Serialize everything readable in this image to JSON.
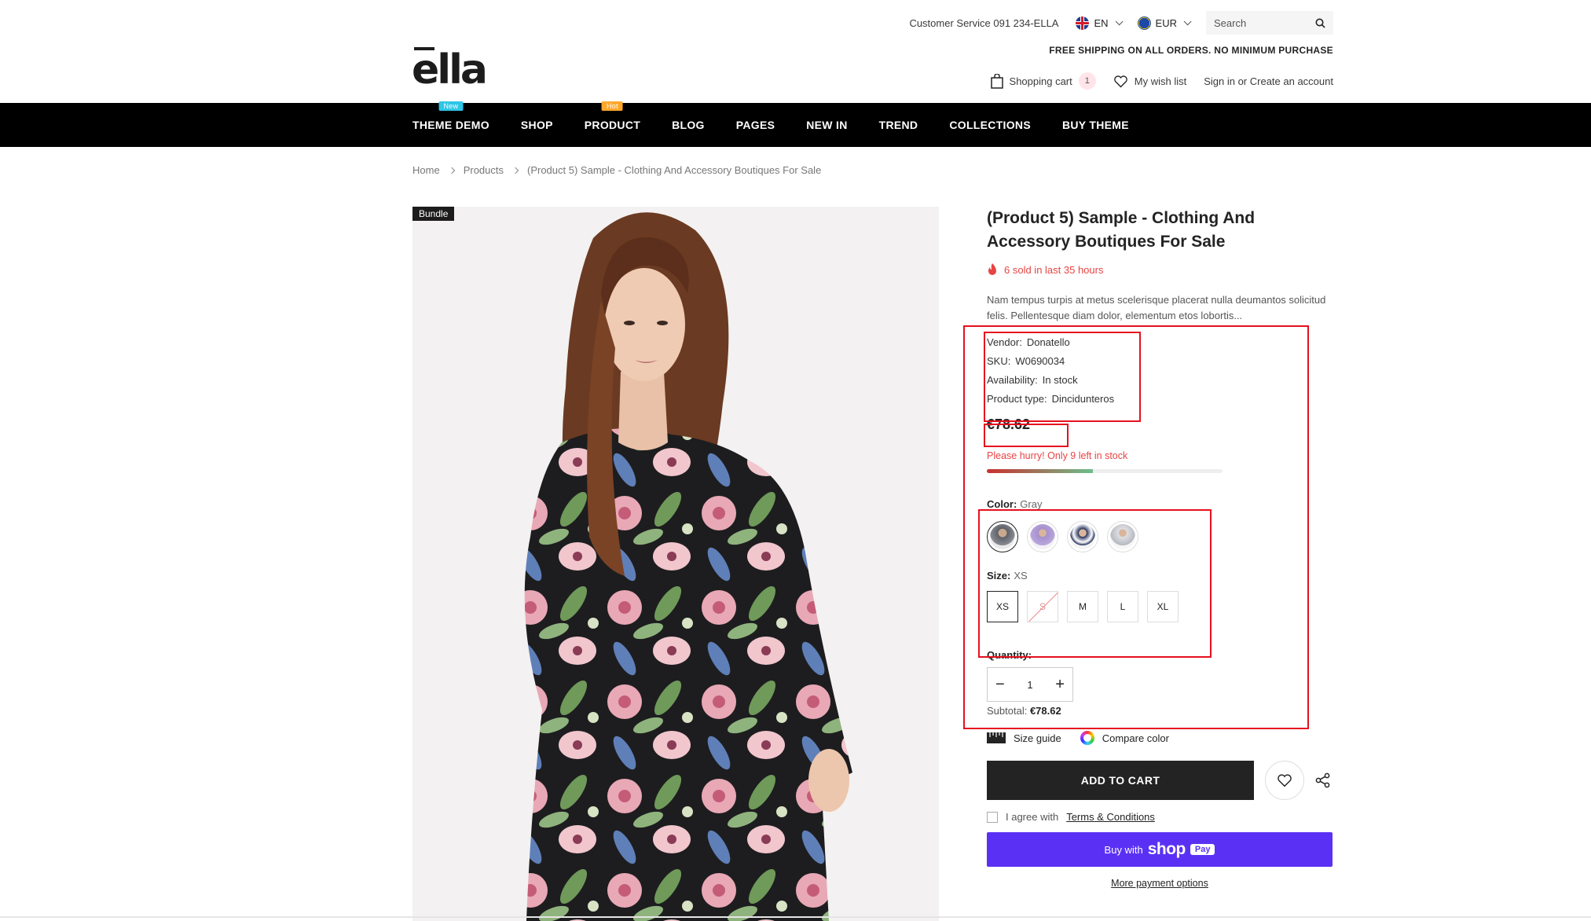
{
  "header": {
    "customer_service": "Customer Service 091 234-ELLA",
    "language": "EN",
    "currency": "EUR",
    "search_placeholder": "Search",
    "free_shipping": "FREE SHIPPING ON ALL ORDERS. NO MINIMUM PURCHASE",
    "logo": "ella",
    "cart_label": "Shopping cart",
    "cart_count": "1",
    "wishlist_label": "My wish list",
    "account_label": "Sign in or Create an account"
  },
  "nav": {
    "items": [
      {
        "label": "THEME DEMO",
        "badge": "New"
      },
      {
        "label": "SHOP",
        "badge": ""
      },
      {
        "label": "PRODUCT",
        "badge": "Hot"
      },
      {
        "label": "BLOG",
        "badge": ""
      },
      {
        "label": "PAGES",
        "badge": ""
      },
      {
        "label": "NEW IN",
        "badge": ""
      },
      {
        "label": "TREND",
        "badge": ""
      },
      {
        "label": "COLLECTIONS",
        "badge": ""
      },
      {
        "label": "BUY THEME",
        "badge": ""
      }
    ]
  },
  "breadcrumb": {
    "home": "Home",
    "products": "Products",
    "current": "(Product 5) Sample - Clothing And Accessory Boutiques For Sale"
  },
  "product": {
    "tag": "Bundle",
    "title": "(Product 5) Sample - Clothing And Accessory Boutiques For Sale",
    "sold_text": "6 sold in last 35 hours",
    "description": "Nam tempus turpis at metus scelerisque placerat nulla deumantos solicitud felis. Pellentesque diam dolor, elementum etos lobortis...",
    "meta": {
      "vendor_label": "Vendor:",
      "vendor": "Donatello",
      "sku_label": "SKU:",
      "sku": "W0690034",
      "availability_label": "Availability:",
      "availability": "In stock",
      "type_label": "Product type:",
      "type": "Dincidunteros"
    },
    "price": "€78.62",
    "hurry_text": "Please hurry! Only 9 left in stock",
    "stock_fill_percent": 45,
    "color_label": "Color:",
    "color_value": "Gray",
    "size_label": "Size:",
    "size_value": "XS",
    "sizes": [
      "XS",
      "S",
      "M",
      "L",
      "XL"
    ],
    "quantity_label": "Quantity:",
    "quantity": "1",
    "subtotal_label": "Subtotal:",
    "subtotal_value": "€78.62",
    "size_guide": "Size guide",
    "compare_color": "Compare color",
    "add_to_cart": "ADD TO CART",
    "agree_text": "I agree with",
    "terms": "Terms & Conditions",
    "buy_with": "Buy with",
    "shop_word": "shop",
    "pay_word": "Pay",
    "more_payment": "More payment options"
  },
  "colors": {
    "accent_red": "#e84444",
    "nav_bg": "#000000",
    "shop_pay": "#5a31f4",
    "annotation": "#e5101f"
  }
}
